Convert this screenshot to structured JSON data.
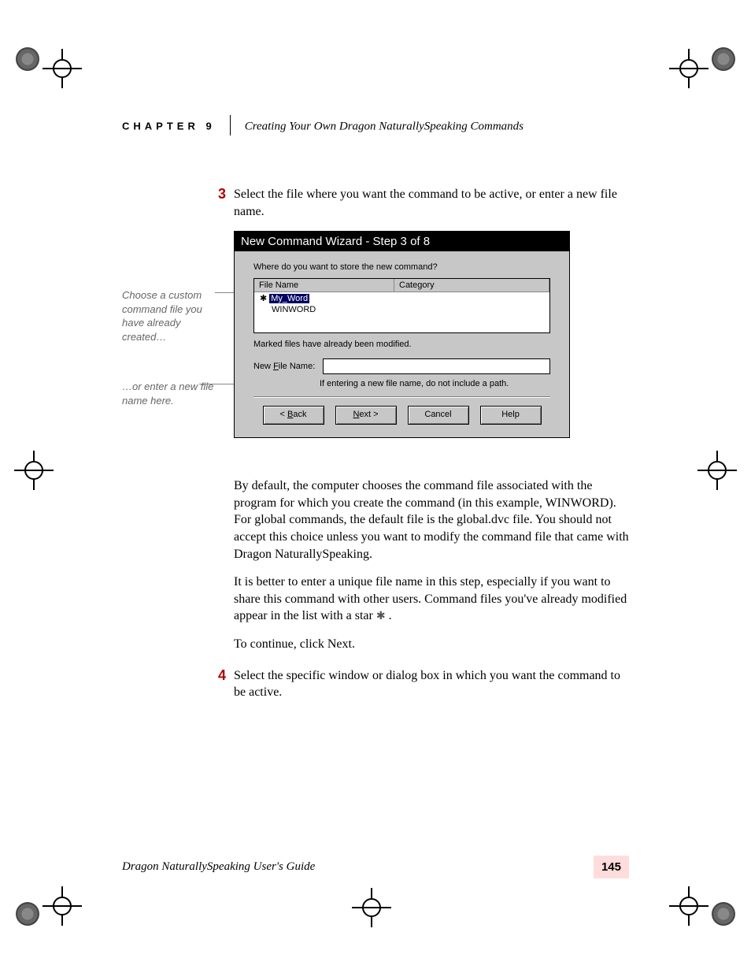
{
  "header": {
    "chapter": "CHAPTER 9",
    "title": "Creating Your Own Dragon NaturallySpeaking Commands"
  },
  "steps": {
    "s3": {
      "num": "3",
      "text": "Select the file where you want the command to be active, or enter a new file name."
    },
    "s4": {
      "num": "4",
      "text": "Select the specific window or dialog box in which you want the command to be active."
    }
  },
  "annotations": {
    "a1": "Choose a custom command file you have already created…",
    "a2": "…or enter a new file name here."
  },
  "dialog": {
    "title": "New Command Wizard - Step 3 of 8",
    "question": "Where do you want to store the new command?",
    "headers": {
      "file": "File Name",
      "category": "Category"
    },
    "rows": [
      {
        "star": "✱",
        "name": "My_Word",
        "selected": true
      },
      {
        "star": "",
        "name": "WINWORD",
        "selected": false
      }
    ],
    "modified_note": "Marked files have already been modified.",
    "new_file_label": "New File Name:",
    "new_file_value": "",
    "hint": "If entering a new file name, do not include a path.",
    "buttons": {
      "back": "< Back",
      "next": "Next >",
      "cancel": "Cancel",
      "help": "Help"
    }
  },
  "body": {
    "p1": "By default, the computer chooses the command file associated with the program for which you create the command (in this example, WINWORD). For global commands, the default file is the global.dvc file. You should not accept this choice unless you want to modify the command file that came with Dragon NaturallySpeaking.",
    "p2a": "It is better to enter a unique file name in this step, especially if you want to share this command with other users. Command files you've already modified appear in the list with a star ",
    "p2b": ".",
    "p3": "To continue, click Next."
  },
  "footer": {
    "title": "Dragon NaturallySpeaking User's Guide",
    "page": "145"
  }
}
